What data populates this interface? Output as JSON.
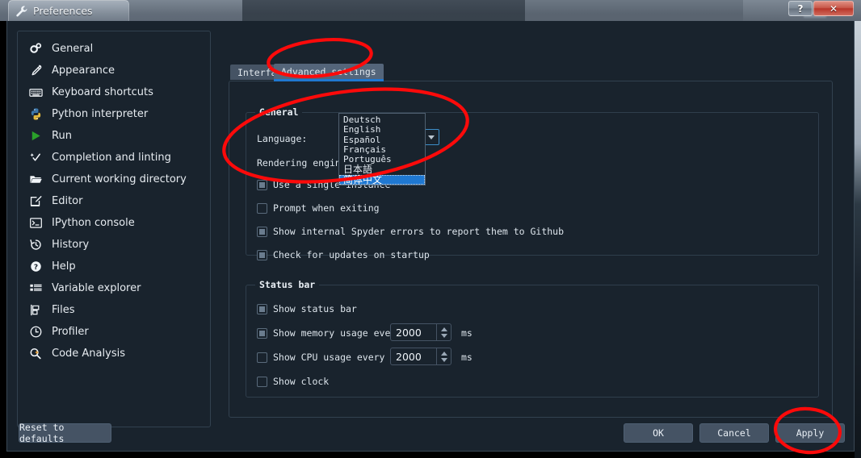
{
  "window": {
    "title": "Preferences",
    "icon": "wrench-icon",
    "help_button": "?",
    "close_button": "✕"
  },
  "sidebar": {
    "items": [
      {
        "label": "General",
        "icon": "gears-icon"
      },
      {
        "label": "Appearance",
        "icon": "eyedropper-icon"
      },
      {
        "label": "Keyboard shortcuts",
        "icon": "keyboard-icon"
      },
      {
        "label": "Python interpreter",
        "icon": "python-icon"
      },
      {
        "label": "Run",
        "icon": "play-icon"
      },
      {
        "label": "Completion and linting",
        "icon": "check-sparkle-icon"
      },
      {
        "label": "Current working directory",
        "icon": "folder-open-icon"
      },
      {
        "label": "Editor",
        "icon": "pencil-square-icon"
      },
      {
        "label": "IPython console",
        "icon": "console-icon"
      },
      {
        "label": "History",
        "icon": "history-icon"
      },
      {
        "label": "Help",
        "icon": "question-circle-icon"
      },
      {
        "label": "Variable explorer",
        "icon": "list-icon"
      },
      {
        "label": "Files",
        "icon": "files-icon"
      },
      {
        "label": "Profiler",
        "icon": "clock-icon"
      },
      {
        "label": "Code Analysis",
        "icon": "code-analysis-icon"
      }
    ]
  },
  "tabs": [
    {
      "label": "Interface",
      "selected": false
    },
    {
      "label": "Advanced settings",
      "selected": true
    }
  ],
  "general_group": {
    "title": "General",
    "language_label": "Language:",
    "language_value": "简体中文",
    "rendering_label": "Rendering engine:",
    "checkboxes": [
      {
        "label": "Use a single instance",
        "checked": true
      },
      {
        "label": "Prompt when exiting",
        "checked": false
      },
      {
        "label": "Show internal Spyder errors to report them to Github",
        "checked": true
      },
      {
        "label": "Check for updates on startup",
        "checked": true
      }
    ]
  },
  "language_dropdown": {
    "open": true,
    "options": [
      {
        "label": "Deutsch",
        "selected": false
      },
      {
        "label": "English",
        "selected": false
      },
      {
        "label": "Español",
        "selected": false
      },
      {
        "label": "Français",
        "selected": false
      },
      {
        "label": "Português",
        "selected": false
      },
      {
        "label": "日本語",
        "selected": false
      },
      {
        "label": "简体中文",
        "selected": true
      }
    ]
  },
  "status_group": {
    "title": "Status bar",
    "rows": [
      {
        "label": "Show status bar",
        "checked": true,
        "value": null,
        "unit": null
      },
      {
        "label": "Show memory usage every",
        "checked": true,
        "value": "2000",
        "unit": "ms"
      },
      {
        "label": "Show CPU usage every",
        "checked": false,
        "value": "2000",
        "unit": "ms"
      },
      {
        "label": "Show clock",
        "checked": false,
        "value": null,
        "unit": null
      }
    ]
  },
  "buttons": {
    "reset": "Reset to defaults",
    "ok": "OK",
    "cancel": "Cancel",
    "apply": "Apply"
  },
  "colors": {
    "background": "#19232d",
    "panel_border": "#32414f",
    "accent": "#1f78d1",
    "button": "#455364",
    "annotation": "#ff0000",
    "close_button": "#b8362a"
  }
}
